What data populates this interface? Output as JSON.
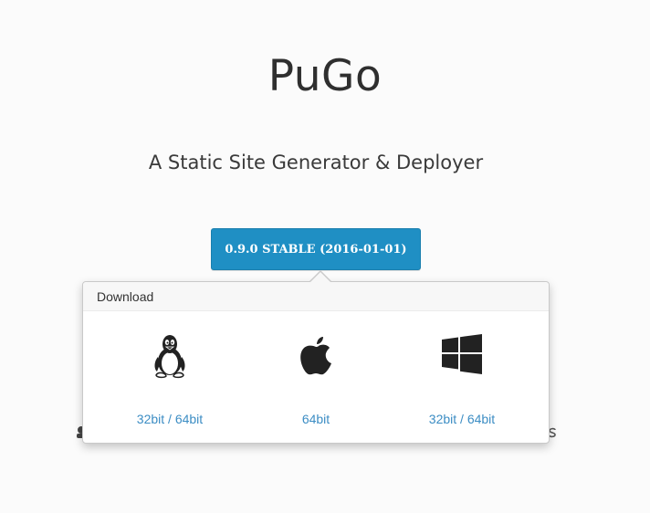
{
  "header": {
    "title": "PuGo",
    "tagline": "A Static Site Generator & Deployer"
  },
  "download_button": {
    "label": "0.9.0 STABLE (2016-01-01)"
  },
  "popover": {
    "title": "Download",
    "items": [
      {
        "os": "linux",
        "icon": "linux-tux-icon",
        "link_label": "32bit / 64bit"
      },
      {
        "os": "mac",
        "icon": "apple-icon",
        "link_label": "64bit"
      },
      {
        "os": "windows",
        "icon": "windows-icon",
        "link_label": "32bit / 64bit"
      }
    ]
  },
  "colors": {
    "button_bg": "#1f8fc4",
    "link": "#3c8dc4",
    "page_bg": "#fbfbfb"
  }
}
